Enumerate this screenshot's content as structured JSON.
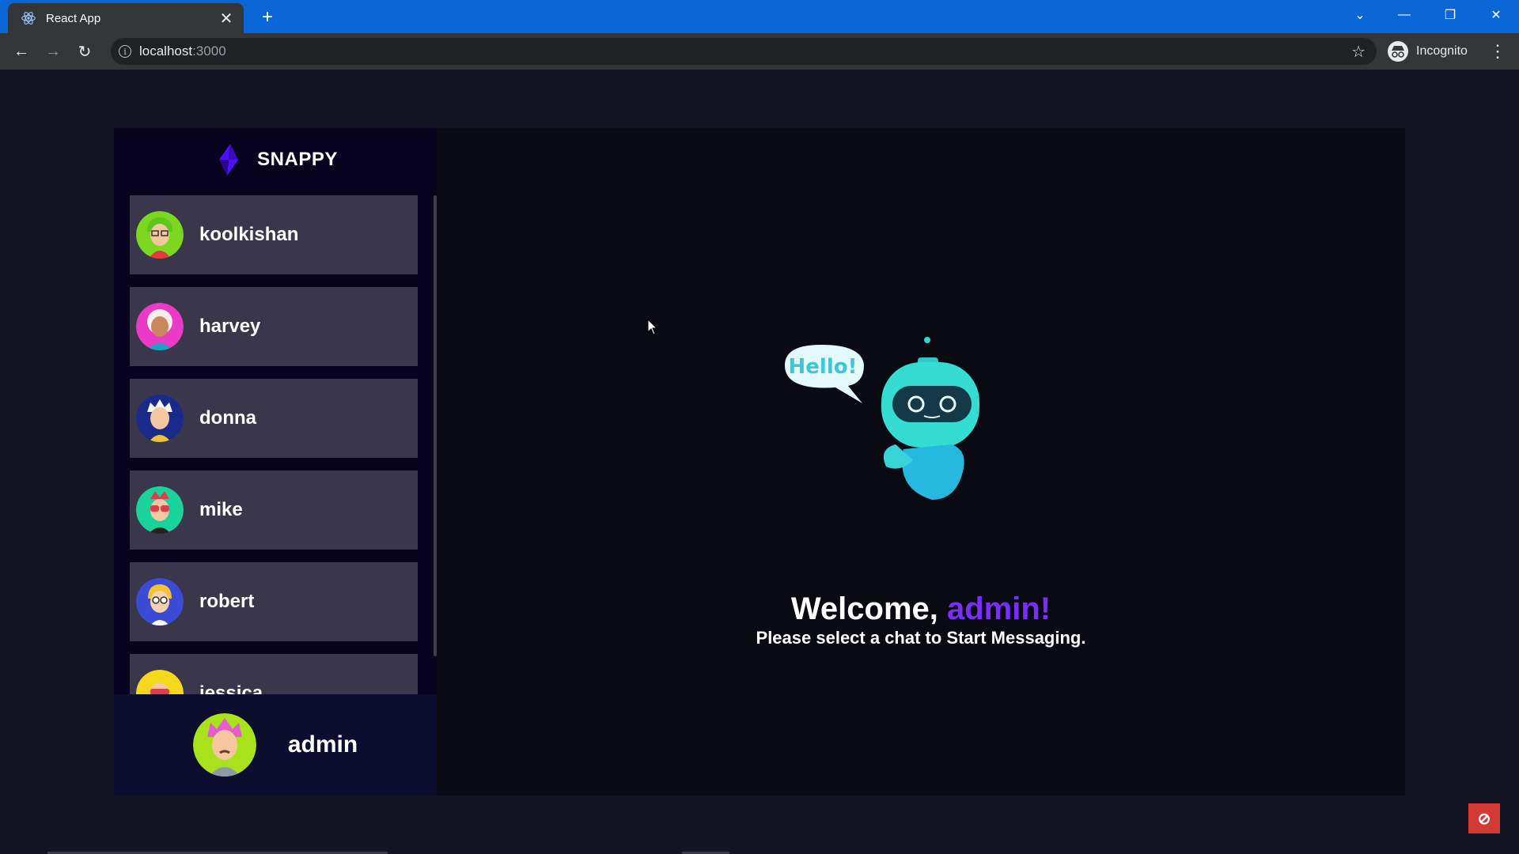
{
  "browser": {
    "tab_title": "React App",
    "url_host": "localhost",
    "url_port": ":3000",
    "profile_label": "Incognito",
    "icons": {
      "favicon": "react-icon",
      "close": "close-icon",
      "new_tab": "plus-icon",
      "back": "back-arrow-icon",
      "forward": "forward-arrow-icon",
      "reload": "reload-icon",
      "info": "info-icon",
      "bookmark": "star-icon",
      "menu": "kebab-menu-icon"
    }
  },
  "app": {
    "brand": "SNAPPY",
    "colors": {
      "background": "#131324",
      "sidebar": "#080420",
      "current_user_bar": "#0d0d30",
      "contact_card": "#ffffff34",
      "accent": "#7b2cff"
    },
    "contacts": [
      {
        "name": "koolkishan",
        "avatar_bg": "#7cd81f",
        "hair": "#7cd81f"
      },
      {
        "name": "harvey",
        "avatar_bg": "#e93bc5",
        "hair": "#f2eee8"
      },
      {
        "name": "donna",
        "avatar_bg": "#1a2a8a",
        "hair": "#f4f4f4"
      },
      {
        "name": "mike",
        "avatar_bg": "#19d39b",
        "hair": "#e33b4b"
      },
      {
        "name": "robert",
        "avatar_bg": "#3b4bd6",
        "hair": "#f2c230"
      },
      {
        "name": "jessica",
        "avatar_bg": "#f5d81c",
        "hair": "#e33b4b"
      }
    ],
    "current_user": {
      "name": "admin",
      "avatar_bg": "#a7e21b"
    },
    "welcome": {
      "greeting": "Welcome,",
      "username": "admin!",
      "subtitle": "Please select a chat to Start Messaging.",
      "robot_bubble_text": "Hello!"
    }
  }
}
